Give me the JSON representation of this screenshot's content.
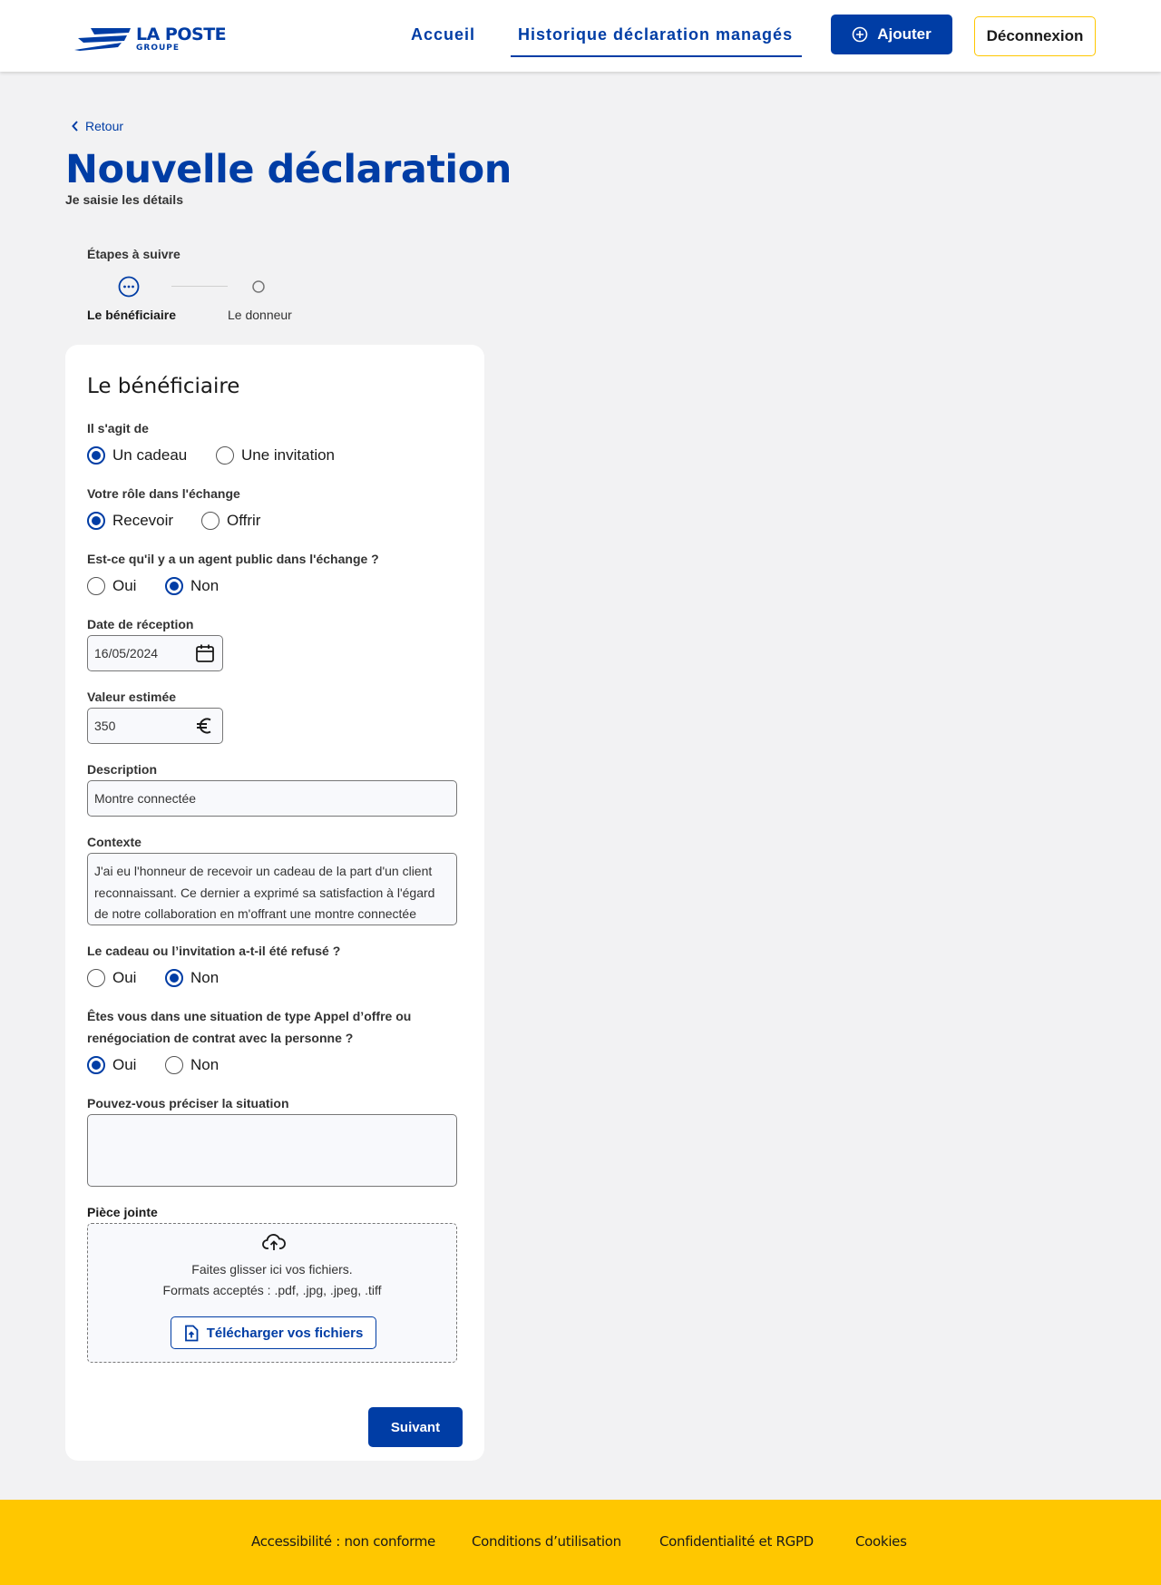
{
  "header": {
    "logo_main": "LA POSTE",
    "logo_sub": "GROUPE",
    "nav_home": "Accueil",
    "nav_history": "Historique déclaration managés",
    "add_label": "Ajouter",
    "logout_label": "Déconnexion"
  },
  "page": {
    "back_label": "Retour",
    "title": "Nouvelle déclaration",
    "subtitle": "Je saisie les détails"
  },
  "stepper": {
    "title": "Étapes à suivre",
    "steps": [
      {
        "label": "Le bénéficiaire",
        "state": "in-progress"
      },
      {
        "label": "Le donneur",
        "state": "pending"
      }
    ]
  },
  "form": {
    "title": "Le bénéficiaire",
    "type_question": "Il s'agit de",
    "type_options": [
      "Un cadeau",
      "Une invitation"
    ],
    "type_selected": "Un cadeau",
    "role_question": "Votre rôle dans l'échange",
    "role_options": [
      "Recevoir",
      "Offrir"
    ],
    "role_selected": "Recevoir",
    "agent_question": "Est-ce qu'il y a un agent public dans l'échange ?",
    "agent_options": [
      "Oui",
      "Non"
    ],
    "agent_selected": "Non",
    "date_label": "Date de réception",
    "date_value": "16/05/2024",
    "value_label": "Valeur estimée",
    "value_value": "350",
    "description_label": "Description",
    "description_value": "Montre connectée",
    "context_label": "Contexte",
    "context_value": "J'ai eu l'honneur de recevoir un cadeau de la part d'un client reconnaissant. Ce dernier a exprimé sa satisfaction à l'égard de notre collaboration en m'offrant une montre connectée",
    "refused_question": "Le cadeau ou l’invitation a-t-il été refusé ?",
    "refused_options": [
      "Oui",
      "Non"
    ],
    "refused_selected": "Non",
    "tender_question": "Êtes vous dans une situation de type Appel d’offre ou renégociation de contrat avec la personne ?",
    "tender_options": [
      "Oui",
      "Non"
    ],
    "tender_selected": "Oui",
    "situation_label": "Pouvez-vous préciser la situation",
    "situation_value": "",
    "attachment_label": "Pièce jointe",
    "dropzone_line1": "Faites glisser ici vos fichiers.",
    "dropzone_line2": "Formats acceptés : .pdf, .jpg, .jpeg, .tiff",
    "upload_label": "Télécharger vos fichiers",
    "next_label": "Suivant"
  },
  "footer": {
    "links": [
      "Accessibilité : non conforme",
      "Conditions d’utilisation",
      "Confidentialité et RGPD",
      "Cookies"
    ]
  },
  "colors": {
    "brand_blue": "#003da5",
    "brand_yellow": "#ffc700",
    "background": "#f2f2f3"
  },
  "icons": [
    "la-poste-logo",
    "plus-circle-icon",
    "chevron-left-icon",
    "in-progress-icon",
    "pending-step-icon",
    "calendar-icon",
    "euro-icon",
    "cloud-upload-icon",
    "file-upload-icon"
  ]
}
